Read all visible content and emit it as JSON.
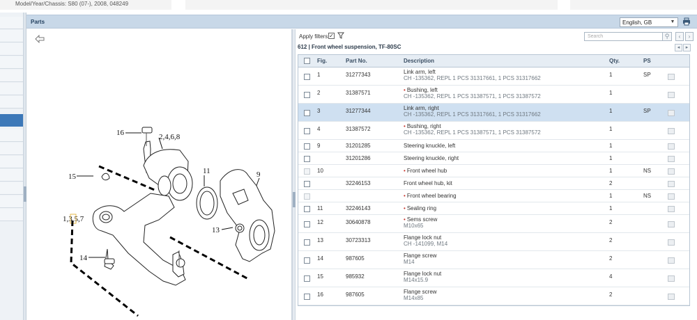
{
  "topbar": {
    "model_text": "Model/Year/Chassis:  S80 (07-), 2008, 048249"
  },
  "parts_panel": {
    "title": "Parts"
  },
  "language": {
    "selected": "English, GB"
  },
  "filter": {
    "label": "Apply filters",
    "checked": true
  },
  "search": {
    "placeholder": "Search"
  },
  "section": {
    "title": "612  |  Front wheel suspension, TF-80SC"
  },
  "table": {
    "headers": {
      "fig": "Fig.",
      "part_no": "Part No.",
      "description": "Description",
      "qty": "Qty.",
      "ps": "PS"
    },
    "rows": [
      {
        "fig": "1",
        "part_no": "31277343",
        "desc": "Link arm, left",
        "sub": "CH -135362, REPL 1 PCS 31317661, 1 PCS 31317662",
        "bullet": false,
        "qty": "1",
        "ps": "SP",
        "selected": false,
        "disabled": false
      },
      {
        "fig": "2",
        "part_no": "31387571",
        "desc": "Bushing, left",
        "sub": "CH -135362, REPL 1 PCS 31387571, 1 PCS 31387572",
        "bullet": true,
        "qty": "1",
        "ps": "",
        "selected": false,
        "disabled": false
      },
      {
        "fig": "3",
        "part_no": "31277344",
        "desc": "Link arm, right",
        "sub": "CH -135362, REPL 1 PCS 31317661, 1 PCS 31317662",
        "bullet": false,
        "qty": "1",
        "ps": "SP",
        "selected": true,
        "disabled": false
      },
      {
        "fig": "4",
        "part_no": "31387572",
        "desc": "Bushing, right",
        "sub": "CH -135362, REPL 1 PCS 31387571, 1 PCS 31387572",
        "bullet": true,
        "qty": "1",
        "ps": "",
        "selected": false,
        "disabled": false
      },
      {
        "fig": "9",
        "part_no": "31201285",
        "desc": "Steering knuckle, left",
        "sub": "",
        "bullet": false,
        "qty": "1",
        "ps": "",
        "selected": false,
        "disabled": false
      },
      {
        "fig": "",
        "part_no": "31201286",
        "desc": "Steering knuckle, right",
        "sub": "",
        "bullet": false,
        "qty": "1",
        "ps": "",
        "selected": false,
        "disabled": false
      },
      {
        "fig": "10",
        "part_no": "",
        "desc": "Front wheel hub",
        "sub": "",
        "bullet": true,
        "qty": "1",
        "ps": "NS",
        "selected": false,
        "disabled": true
      },
      {
        "fig": "",
        "part_no": "32246153",
        "desc": "Front wheel hub, kit",
        "sub": "",
        "bullet": false,
        "qty": "2",
        "ps": "",
        "selected": false,
        "disabled": false
      },
      {
        "fig": "",
        "part_no": "",
        "desc": "Front wheel bearing",
        "sub": "",
        "bullet": true,
        "qty": "1",
        "ps": "NS",
        "selected": false,
        "disabled": true
      },
      {
        "fig": "11",
        "part_no": "32246143",
        "desc": "Sealing ring",
        "sub": "",
        "bullet": true,
        "qty": "1",
        "ps": "",
        "selected": false,
        "disabled": false
      },
      {
        "fig": "12",
        "part_no": "30640878",
        "desc": "Sems screw",
        "sub": "M10x65",
        "bullet": true,
        "qty": "2",
        "ps": "",
        "selected": false,
        "disabled": false
      },
      {
        "fig": "13",
        "part_no": "30723313",
        "desc": "Flange lock nut",
        "sub": "CH -141099, M14",
        "bullet": false,
        "qty": "2",
        "ps": "",
        "selected": false,
        "disabled": false
      },
      {
        "fig": "14",
        "part_no": "987605",
        "desc": "Flange screw",
        "sub": "M14",
        "bullet": false,
        "qty": "2",
        "ps": "",
        "selected": false,
        "disabled": false
      },
      {
        "fig": "15",
        "part_no": "985932",
        "desc": "Flange lock nut",
        "sub": "M14x15.9",
        "bullet": false,
        "qty": "4",
        "ps": "",
        "selected": false,
        "disabled": false
      },
      {
        "fig": "16",
        "part_no": "987605",
        "desc": "Flange screw",
        "sub": "M14x85",
        "bullet": false,
        "qty": "2",
        "ps": "",
        "selected": false,
        "disabled": false
      }
    ]
  },
  "diagram": {
    "labels": {
      "l16": "16",
      "l2468": "2,4,6,8",
      "l15": "15",
      "l11": "11",
      "l9": "9",
      "l1357": "1,3,5,7",
      "l13": "13",
      "l14": "14"
    }
  }
}
